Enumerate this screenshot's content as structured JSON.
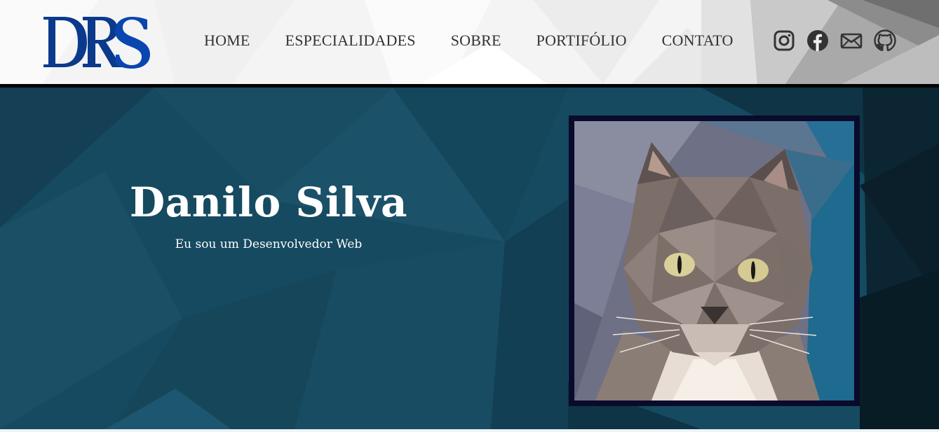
{
  "header": {
    "logo_text": "DRS",
    "nav": [
      {
        "label": "HOME"
      },
      {
        "label": "ESPECIALIDADES"
      },
      {
        "label": "SOBRE"
      },
      {
        "label": "PORTIFÓLIO"
      },
      {
        "label": "CONTATO"
      }
    ],
    "social_icons": [
      "instagram-icon",
      "facebook-icon",
      "mail-icon",
      "github-icon"
    ]
  },
  "hero": {
    "name": "Danilo Silva",
    "subtitle": "Eu sou um Desenvolvedor Web"
  },
  "colors": {
    "logo_blue": "#0b3a8c",
    "nav_text": "#333333",
    "hero_bg": "#164a60",
    "divider": "#000000",
    "frame": "#0a0a2a"
  }
}
